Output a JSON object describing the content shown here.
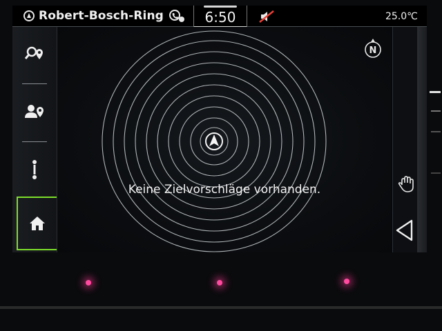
{
  "header": {
    "street": "Robert-Bosch-Ring",
    "time": "6:50",
    "temperature": "25.0℃",
    "location_icon": "navigation-arrow-icon",
    "phone_icon": "phone-status-icon",
    "mute_icon": "speaker-muted-icon"
  },
  "sidebar": {
    "items": [
      {
        "icon": "destination-search-icon",
        "active": false
      },
      {
        "icon": "contact-destination-icon",
        "active": false
      },
      {
        "icon": "route-icon",
        "active": false
      },
      {
        "icon": "home-icon",
        "active": true
      }
    ]
  },
  "map": {
    "message": "Keine Zielvorschläge vorhanden.",
    "compass_label": "N"
  },
  "rightbar": {
    "gesture_icon": "hand-gesture-icon",
    "back_icon": "back-triangle-icon"
  },
  "colors": {
    "active_accent": "#7ee02a",
    "mute_accent": "#e8433a",
    "ambient_light": "#ff4aa0"
  }
}
